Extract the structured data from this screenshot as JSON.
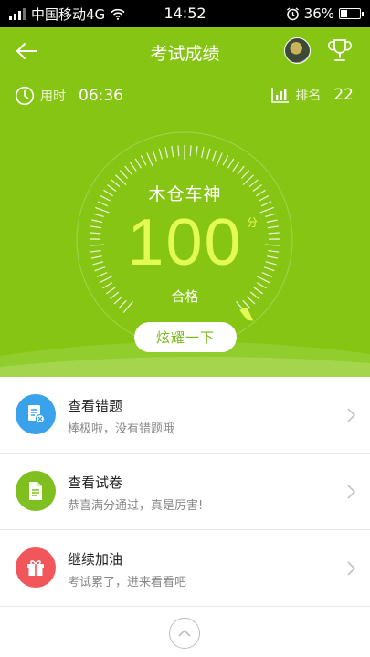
{
  "status_bar": {
    "carrier": "中国移动4G",
    "time": "14:52",
    "battery": "36%",
    "battery_level": 0.36
  },
  "header": {
    "title": "考试成绩"
  },
  "stats": {
    "time_label": "用时",
    "time_value": "06:36",
    "rank_label": "排名",
    "rank_value": "22"
  },
  "result": {
    "name": "木仓车神",
    "score": "100",
    "score_unit": "分",
    "grade": "合格",
    "share_label": "炫耀一下"
  },
  "list": [
    {
      "title": "查看错题",
      "subtitle": "棒极啦，没有错题哦",
      "icon": "wrong-questions-icon",
      "color": "#3aa2ea"
    },
    {
      "title": "查看试卷",
      "subtitle": "恭喜满分通过，真是厉害!",
      "icon": "paper-icon",
      "color": "#7fbf1f"
    },
    {
      "title": "继续加油",
      "subtitle": "考试累了，进来看看吧",
      "icon": "gift-icon",
      "color": "#f0565a"
    }
  ],
  "colors": {
    "hero_green": "#86c514",
    "score_yellow": "#e4fa55"
  }
}
